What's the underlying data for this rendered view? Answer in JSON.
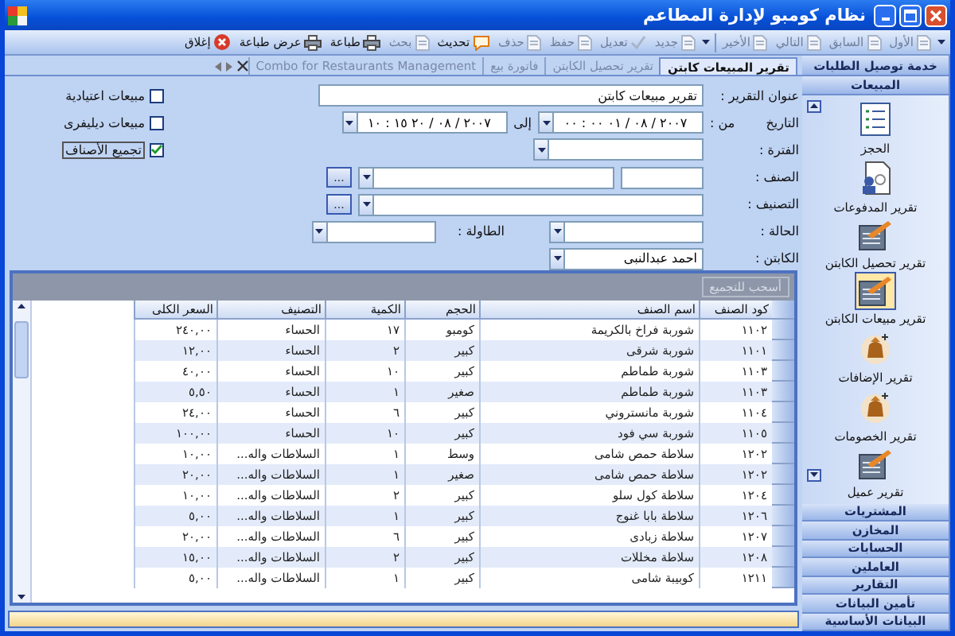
{
  "window": {
    "title": "نظام كومبو لإدارة المطاعم"
  },
  "toolbar": {
    "navigation": [
      {
        "label": "الأول",
        "disabled": true
      },
      {
        "label": "السابق",
        "disabled": true
      },
      {
        "label": "التالي",
        "disabled": true
      },
      {
        "label": "الأخير",
        "disabled": true
      }
    ],
    "actions": [
      {
        "label": "جديد",
        "disabled": true
      },
      {
        "label": "تعديل",
        "disabled": true
      },
      {
        "label": "حفظ",
        "disabled": true
      },
      {
        "label": "حذف",
        "disabled": true
      },
      {
        "label": "تحديث",
        "disabled": false
      },
      {
        "label": "بحث",
        "disabled": true
      },
      {
        "label": "طباعة",
        "disabled": false
      },
      {
        "label": "عرض طباعة",
        "disabled": false
      },
      {
        "label": "إغلاق",
        "disabled": false
      }
    ]
  },
  "tabs": [
    {
      "label": "تقرير المبيعات كابتن",
      "selected": true
    },
    {
      "label": "تقرير تحصيل الكابتن",
      "selected": false
    },
    {
      "label": "فاتورة بيع",
      "selected": false
    },
    {
      "label": "Combo for Restaurants Management",
      "selected": false
    }
  ],
  "form": {
    "title_label": "عنوان التقرير :",
    "title_value": "تقرير مبيعات كابتن",
    "date_label": "التاريخ",
    "from_label": "من :",
    "date_from": "٢٠٠٧ / ٠٨ / ٠١    ٠٠ : ٠٠",
    "to_label": "إلى",
    "date_to": "٢٠٠٧ / ٠٨ / ٢٠    ١٥ : ١٠",
    "period_label": "الفترة :",
    "item_label": "الصنف :",
    "category_label": "التصنيف :",
    "status_label": "الحالة :",
    "table_label": "الطاولة :",
    "captain_label": "الكابتن :",
    "captain_value": "احمد عبدالنبى",
    "browse_buttons": [
      "...",
      "..."
    ],
    "options": [
      {
        "label": "مبيعات اعتيادية",
        "checked": false
      },
      {
        "label": "مبيعات ديليفرى",
        "checked": false
      },
      {
        "label": "تجميع الأصناف",
        "checked": true
      }
    ]
  },
  "grid": {
    "group_panel": "أسحب للتجميع",
    "columns": [
      "كود الصنف",
      "اسم الصنف",
      "الحجم",
      "الكمية",
      "التصنيف",
      "السعر الكلى"
    ],
    "rows": [
      [
        "١١٠٢",
        "شوربة فراخ بالكريمة",
        "كومبو",
        "١٧",
        "الحساء",
        "٢٤٠,٠٠"
      ],
      [
        "١١٠١",
        "شوربة شرقى",
        "كبير",
        "٢",
        "الحساء",
        "١٢,٠٠"
      ],
      [
        "١١٠٣",
        "شوربة طماطم",
        "كبير",
        "١٠",
        "الحساء",
        "٤٠,٠٠"
      ],
      [
        "١١٠٣",
        "شوربة طماطم",
        "صغير",
        "١",
        "الحساء",
        "٥,٥٠"
      ],
      [
        "١١٠٤",
        "شوربة مانستروني",
        "كبير",
        "٦",
        "الحساء",
        "٢٤,٠٠"
      ],
      [
        "١١٠٥",
        "شوربة سي فود",
        "كبير",
        "١٠",
        "الحساء",
        "١٠٠,٠٠"
      ],
      [
        "١٢٠٢",
        "سلاطة حمص شامى",
        "وسط",
        "١",
        "السلاطات واله...",
        "١٠,٠٠"
      ],
      [
        "١٢٠٢",
        "سلاطة حمص شامى",
        "صغير",
        "١",
        "السلاطات واله...",
        "٢٠,٠٠"
      ],
      [
        "١٢٠٤",
        "سلاطة كول سلو",
        "كبير",
        "٢",
        "السلاطات واله...",
        "١٠,٠٠"
      ],
      [
        "١٢٠٦",
        "سلاطة بابا غنوج",
        "كبير",
        "١",
        "السلاطات واله...",
        "٥,٠٠"
      ],
      [
        "١٢٠٧",
        "سلاطة زبادى",
        "كبير",
        "٦",
        "السلاطات واله...",
        "٢٠,٠٠"
      ],
      [
        "١٢٠٨",
        "سلاطة مخللات",
        "كبير",
        "٢",
        "السلاطات واله...",
        "١٥,٠٠"
      ],
      [
        "١٢١١",
        "كوبيبة شامى",
        "كبير",
        "١",
        "السلاطات واله...",
        "٥,٠٠"
      ]
    ]
  },
  "sidebar": {
    "top_group": "خدمة توصيل الطلبات",
    "open_group": "المبيعات",
    "items": [
      {
        "label": "الحجز",
        "selected": false
      },
      {
        "label": "تقرير المدفوعات",
        "selected": false
      },
      {
        "label": "تقرير تحصيل الكابتن",
        "selected": false
      },
      {
        "label": "تقرير مبيعات الكابتن",
        "selected": true
      },
      {
        "label": "تقرير الإضافات",
        "selected": false
      },
      {
        "label": "تقرير الخصومات",
        "selected": false
      },
      {
        "label": "تقرير عميل",
        "selected": false
      }
    ],
    "groups": [
      "المشتريات",
      "المخازن",
      "الحسابات",
      "العاملين",
      "التقارير",
      "تأمين البيانات",
      "البيانات الأساسية"
    ]
  }
}
